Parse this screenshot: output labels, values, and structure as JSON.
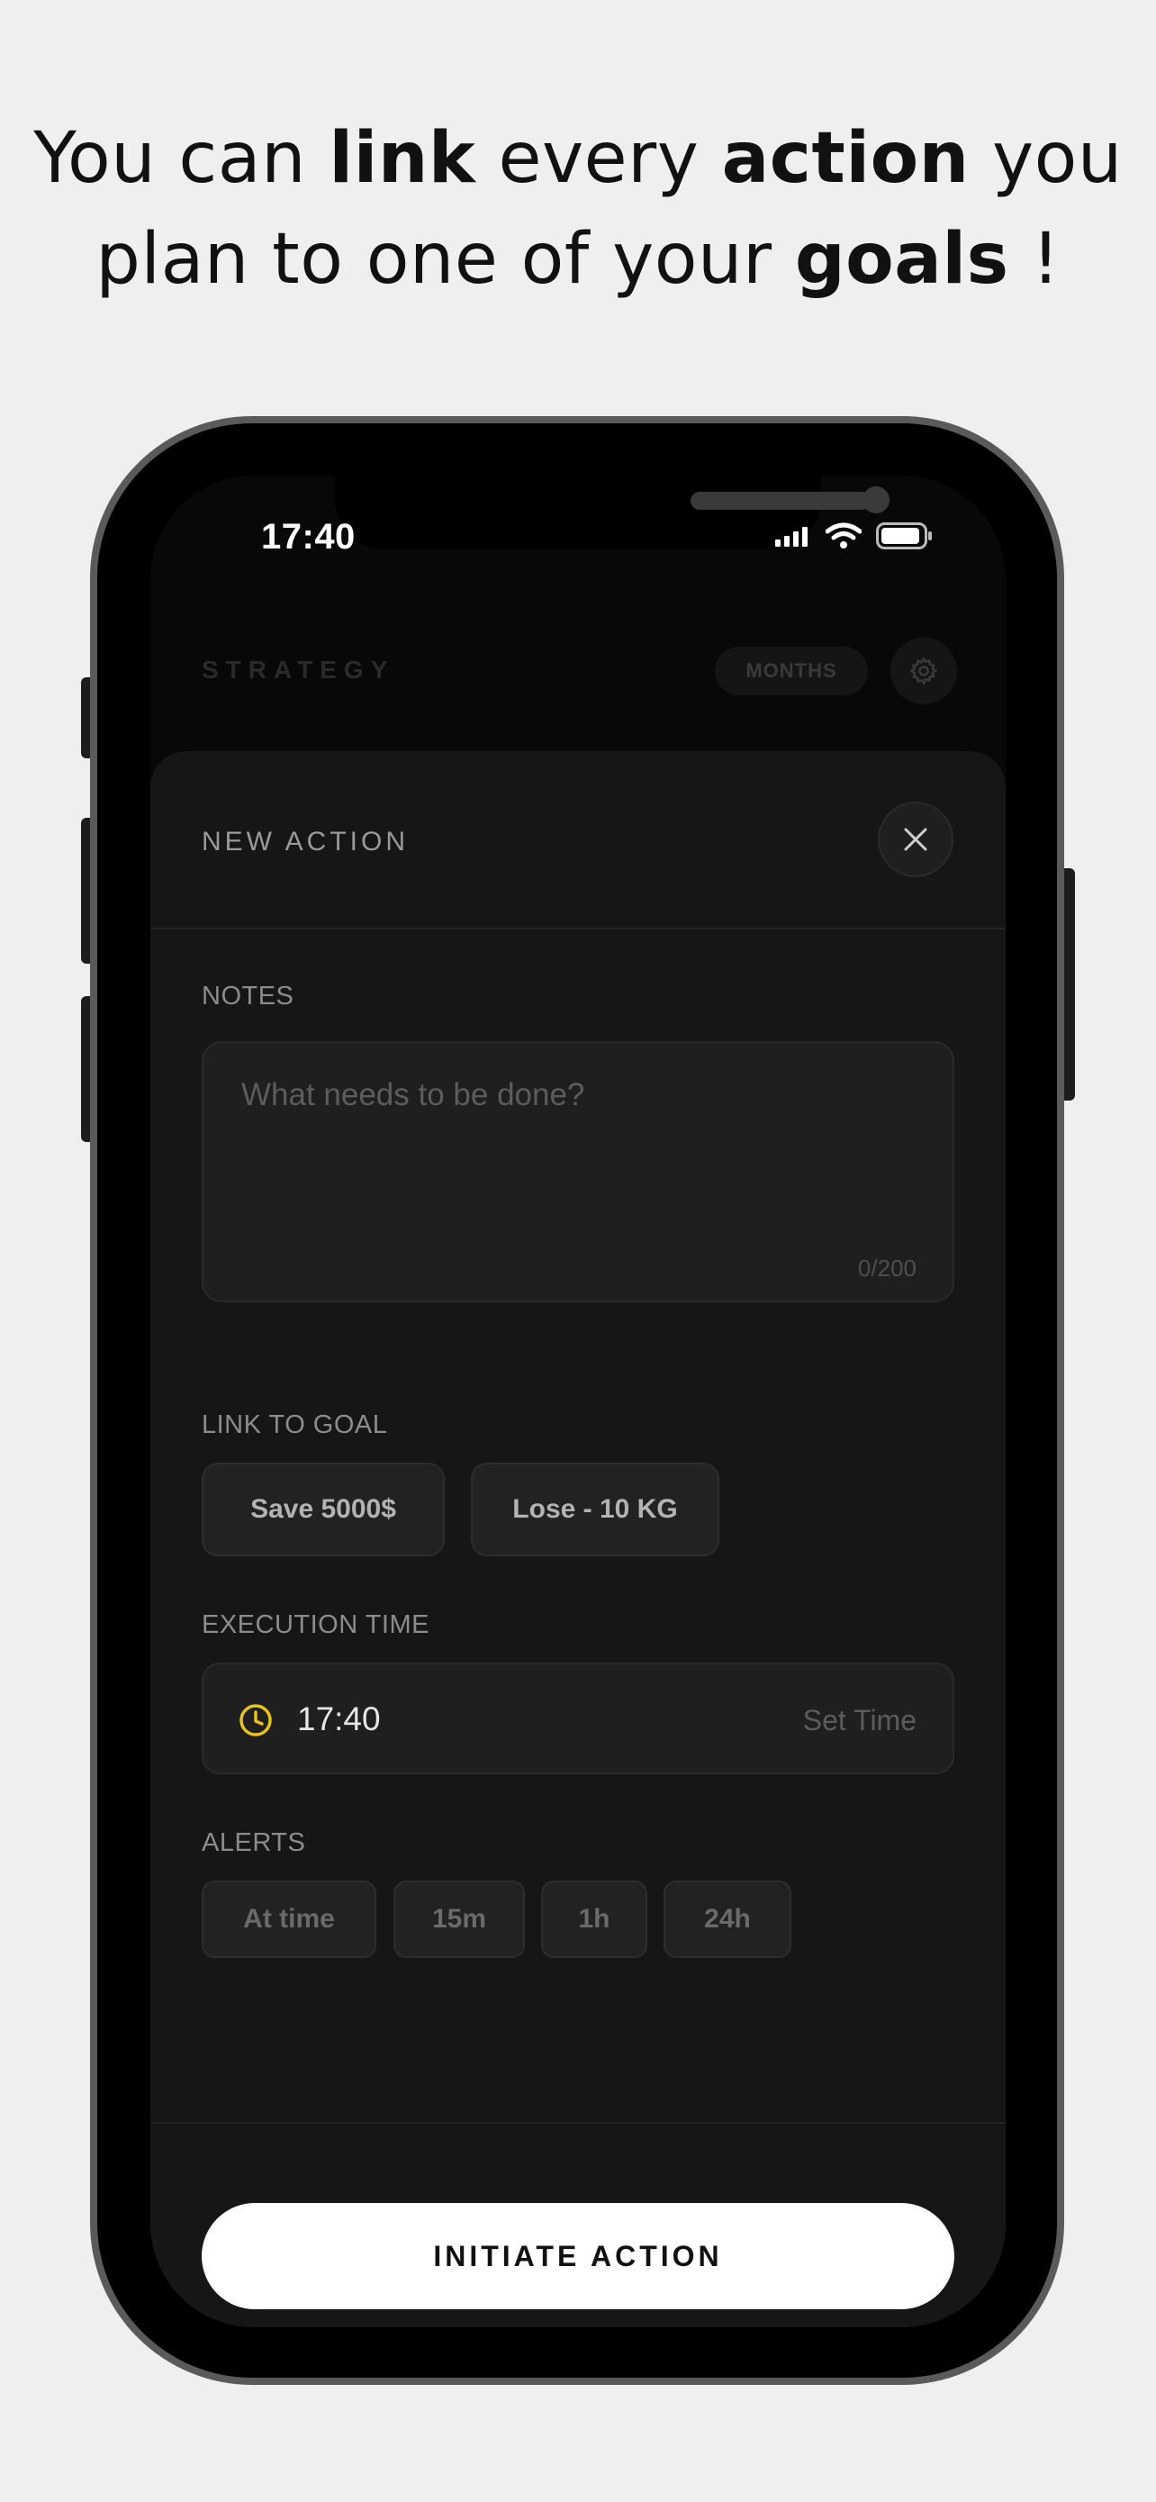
{
  "headline": {
    "part1": "You can ",
    "bold1": "link",
    "part2": " every ",
    "bold2": "action",
    "part3": " you plan to one of your ",
    "bold3": "goals",
    "part4": " !"
  },
  "status_bar": {
    "time": "17:40"
  },
  "app_header": {
    "title": "STRATEGY",
    "view_toggle": "MONTHS",
    "settings_icon": "gear-icon"
  },
  "sheet": {
    "title": "NEW ACTION",
    "close_icon": "close-icon",
    "notes": {
      "label": "NOTES",
      "placeholder": "What needs to be done?",
      "value": "",
      "counter": "0/200"
    },
    "goals": {
      "label": "LINK TO GOAL",
      "options": [
        "Save 5000$",
        "Lose - 10 KG"
      ]
    },
    "execution": {
      "label": "EXECUTION TIME",
      "icon": "clock-icon",
      "value": "17:40",
      "action": "Set Time"
    },
    "alerts": {
      "label": "ALERTS",
      "options": [
        "At time",
        "15m",
        "1h",
        "24h"
      ]
    },
    "cta": "INITIATE ACTION"
  },
  "colors": {
    "accent_clock": "#e8c21f",
    "cta_bg": "#ffffff",
    "sheet_bg": "#161616"
  }
}
